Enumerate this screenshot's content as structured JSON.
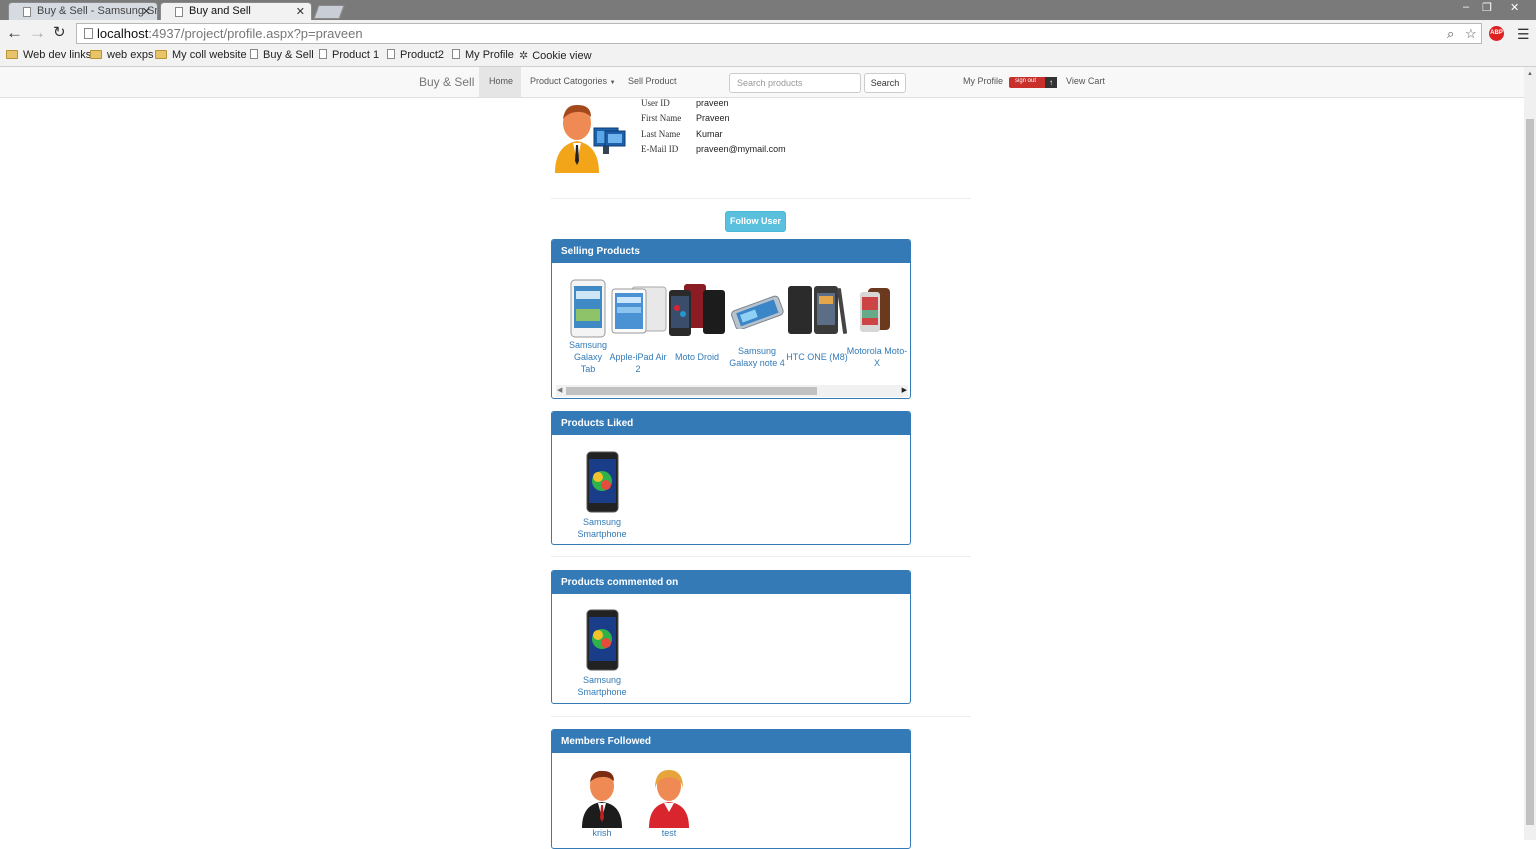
{
  "browser": {
    "tabs": [
      {
        "title": "Buy & Sell - Samsung Sm",
        "active": false
      },
      {
        "title": "Buy and Sell",
        "active": true
      }
    ],
    "url_host": "localhost",
    "url_path": ":4937/project/profile.aspx?p=praveen",
    "bookmarks": [
      {
        "label": "Web dev links",
        "icon": "folder-icon"
      },
      {
        "label": "web exps",
        "icon": "folder-icon"
      },
      {
        "label": "My coll website",
        "icon": "folder-icon"
      },
      {
        "label": "Buy & Sell",
        "icon": "page-icon"
      },
      {
        "label": "Product 1",
        "icon": "page-icon"
      },
      {
        "label": "Product2",
        "icon": "page-icon"
      },
      {
        "label": "My Profile",
        "icon": "page-icon"
      },
      {
        "label": "Cookie view",
        "icon": "gear-icon"
      }
    ],
    "extension_label": "ABP"
  },
  "nav": {
    "brand": "Buy & Sell",
    "home": "Home",
    "categories": "Product Catogories",
    "sell": "Sell Product",
    "search_placeholder": "Search products",
    "search_button": "Search",
    "my_profile": "My Profile",
    "sign_out": "sign out",
    "view_cart": "View Cart"
  },
  "profile": {
    "rows": [
      {
        "label": "User ID",
        "value": "praveen"
      },
      {
        "label": "First Name",
        "value": "Praveen"
      },
      {
        "label": "Last Name",
        "value": "Kumar"
      },
      {
        "label": "E-Mail ID",
        "value": "praveen@mymail.com"
      }
    ],
    "follow_button": "Follow User"
  },
  "panels": {
    "selling": {
      "title": "Selling Products",
      "items": [
        {
          "line1": "Samsung",
          "line2": "Galaxy",
          "line3": "Tab"
        },
        {
          "line1": "Apple-iPad Air 2"
        },
        {
          "line1": "Moto Droid"
        },
        {
          "line1": "Samsung",
          "line2": "Galaxy note 4"
        },
        {
          "line1": "HTC ONE (M8)"
        },
        {
          "line1": "Motorola Moto-",
          "line2": "X"
        }
      ]
    },
    "liked": {
      "title": "Products Liked",
      "items": [
        {
          "line1": "Samsung",
          "line2": "Smartphone"
        }
      ]
    },
    "commented": {
      "title": "Products commented on",
      "items": [
        {
          "line1": "Samsung",
          "line2": "Smartphone"
        }
      ]
    },
    "followed": {
      "title": "Members Followed",
      "items": [
        {
          "name": "krish"
        },
        {
          "name": "test"
        }
      ]
    }
  },
  "colors": {
    "panel_primary": "#337ab7",
    "follow_button": "#5bc0de",
    "sign_out": "#c9302c"
  }
}
